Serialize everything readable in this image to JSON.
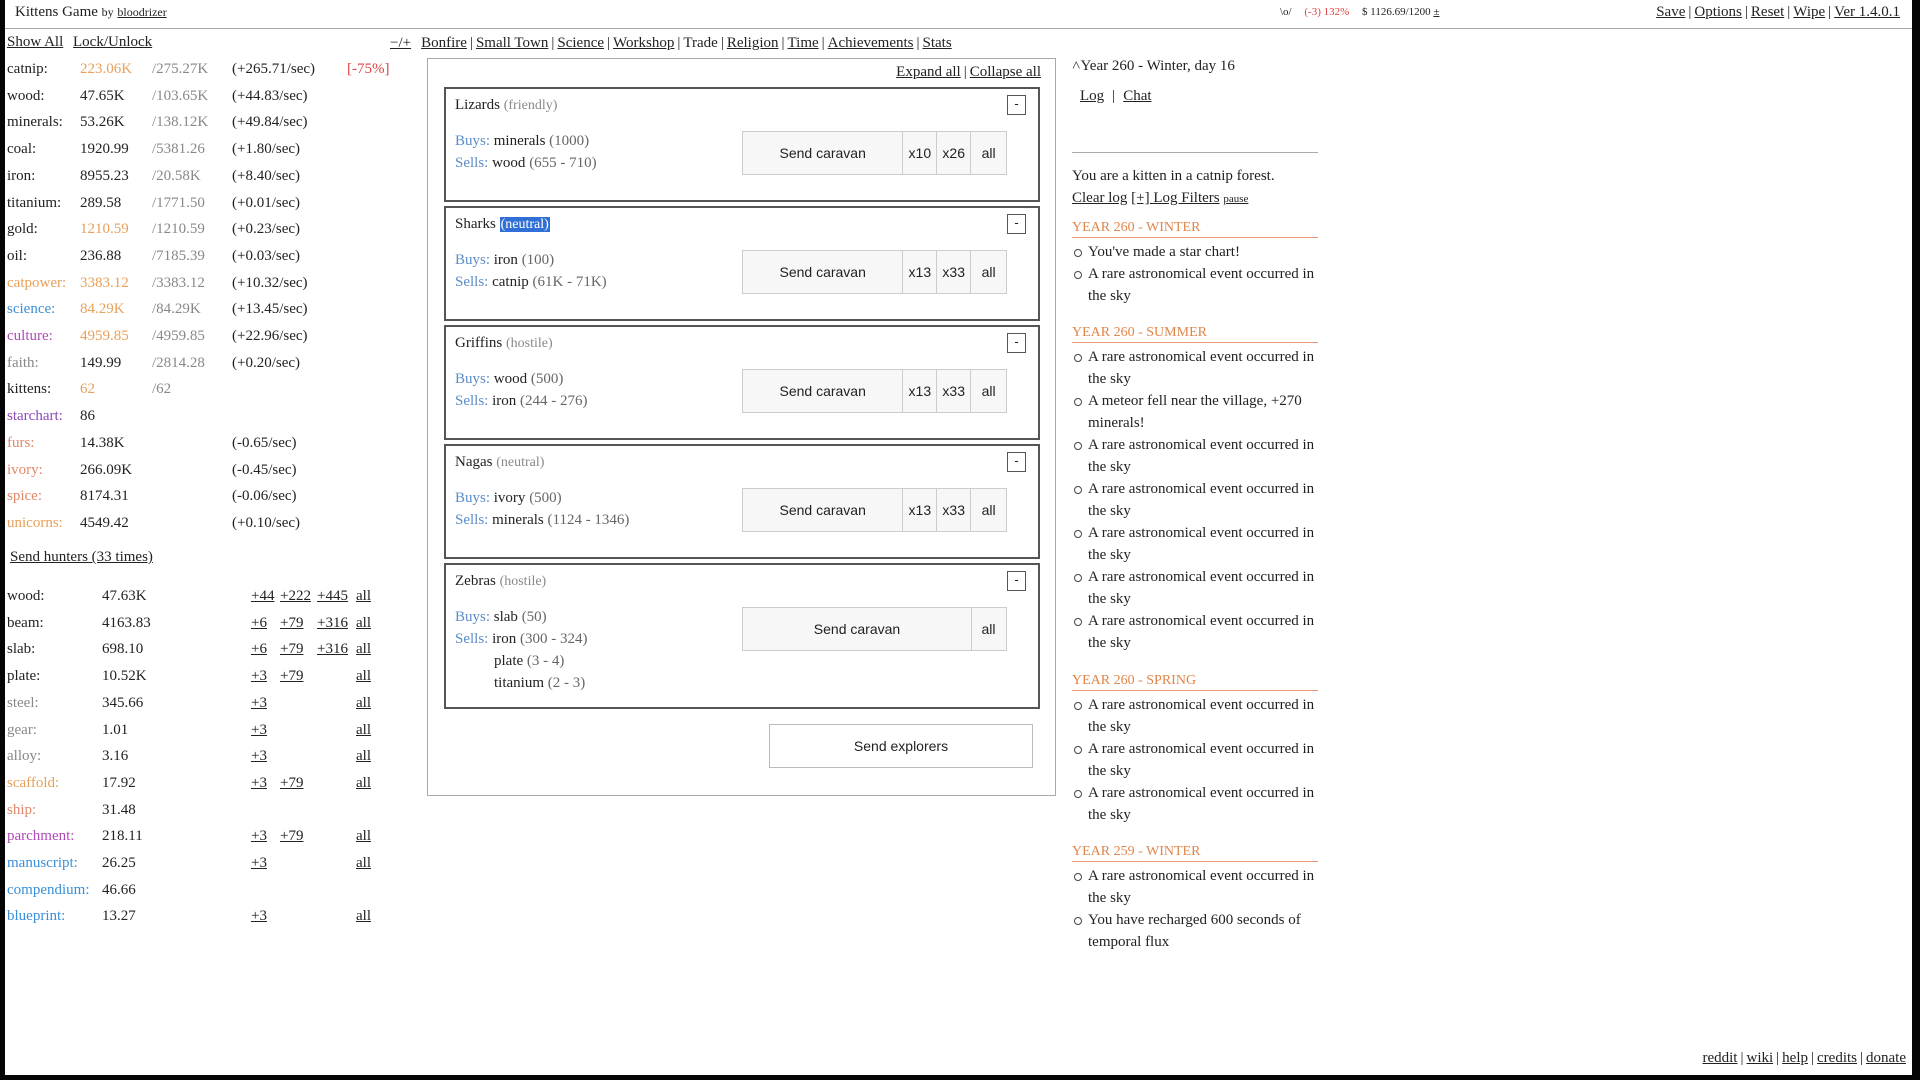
{
  "header": {
    "title": "Kittens Game",
    "by": "by",
    "author": "bloodrizer",
    "status_icon": "\\o/",
    "status_happiness": "(-3) 132%",
    "status_money": "$ 1126.69/1200",
    "status_more": "±",
    "menu": [
      "Save",
      "Options",
      "Reset",
      "Wipe",
      "Ver 1.4.0.1"
    ]
  },
  "left_controls": {
    "show_all": "Show All",
    "lock_unlock": "Lock/Unlock"
  },
  "resources": [
    {
      "name": "catnip:",
      "amount": "223.06K",
      "max": "/275.27K",
      "rate": "(+265.71/sec)",
      "mod": "[-75%]",
      "name_color": "#222",
      "amount_color": "#e8a05a"
    },
    {
      "name": "wood:",
      "amount": "47.65K",
      "max": "/103.65K",
      "rate": "(+44.83/sec)",
      "mod": "",
      "name_color": "#222",
      "amount_color": "#222"
    },
    {
      "name": "minerals:",
      "amount": "53.26K",
      "max": "/138.12K",
      "rate": "(+49.84/sec)",
      "mod": "",
      "name_color": "#222",
      "amount_color": "#222"
    },
    {
      "name": "coal:",
      "amount": "1920.99",
      "max": "/5381.26",
      "rate": "(+1.80/sec)",
      "mod": "",
      "name_color": "#222",
      "amount_color": "#222"
    },
    {
      "name": "iron:",
      "amount": "8955.23",
      "max": "/20.58K",
      "rate": "(+8.40/sec)",
      "mod": "",
      "name_color": "#222",
      "amount_color": "#222"
    },
    {
      "name": "titanium:",
      "amount": "289.58",
      "max": "/1771.50",
      "rate": "(+0.01/sec)",
      "mod": "",
      "name_color": "#222",
      "amount_color": "#222"
    },
    {
      "name": "gold:",
      "amount": "1210.59",
      "max": "/1210.59",
      "rate": "(+0.23/sec)",
      "mod": "",
      "name_color": "#222",
      "amount_color": "#e8a05a"
    },
    {
      "name": "oil:",
      "amount": "236.88",
      "max": "/7185.39",
      "rate": "(+0.03/sec)",
      "mod": "",
      "name_color": "#222",
      "amount_color": "#222"
    },
    {
      "name": "catpower:",
      "amount": "3383.12",
      "max": "/3383.12",
      "rate": "(+10.32/sec)",
      "mod": "",
      "name_color": "#e8a05a",
      "amount_color": "#e8a05a"
    },
    {
      "name": "science:",
      "amount": "84.29K",
      "max": "/84.29K",
      "rate": "(+13.45/sec)",
      "mod": "",
      "name_color": "#3a8fd8",
      "amount_color": "#e8a05a"
    },
    {
      "name": "culture:",
      "amount": "4959.85",
      "max": "/4959.85",
      "rate": "(+22.96/sec)",
      "mod": "",
      "name_color": "#b04ab8",
      "amount_color": "#e8a05a"
    },
    {
      "name": "faith:",
      "amount": "149.99",
      "max": "/2814.28",
      "rate": "(+0.20/sec)",
      "mod": "",
      "name_color": "#888",
      "amount_color": "#222"
    },
    {
      "name": "kittens:",
      "amount": "62",
      "max": "/62",
      "rate": "",
      "mod": "",
      "name_color": "#222",
      "amount_color": "#e8a05a"
    },
    {
      "name": "starchart:",
      "amount": "86",
      "max": "",
      "rate": "",
      "mod": "",
      "name_color": "#8a4ab8",
      "amount_color": "#222"
    },
    {
      "name": "furs:",
      "amount": "14.38K",
      "max": "",
      "rate": "(-0.65/sec)",
      "mod": "",
      "name_color": "#e0886a",
      "amount_color": "#222"
    },
    {
      "name": "ivory:",
      "amount": "266.09K",
      "max": "",
      "rate": "(-0.45/sec)",
      "mod": "",
      "name_color": "#e0886a",
      "amount_color": "#222"
    },
    {
      "name": "spice:",
      "amount": "8174.31",
      "max": "",
      "rate": "(-0.06/sec)",
      "mod": "",
      "name_color": "#e0886a",
      "amount_color": "#222"
    },
    {
      "name": "unicorns:",
      "amount": "4549.42",
      "max": "",
      "rate": "(+0.10/sec)",
      "mod": "",
      "name_color": "#e8a05a",
      "amount_color": "#222"
    }
  ],
  "send_hunters": "Send hunters (33 times)",
  "crafts": [
    {
      "name": "wood:",
      "amount": "47.63K",
      "a": "+44",
      "b": "+222",
      "c": "+445",
      "all": "all",
      "name_color": "#222"
    },
    {
      "name": "beam:",
      "amount": "4163.83",
      "a": "+6",
      "b": "+79",
      "c": "+316",
      "all": "all",
      "name_color": "#222"
    },
    {
      "name": "slab:",
      "amount": "698.10",
      "a": "+6",
      "b": "+79",
      "c": "+316",
      "all": "all",
      "name_color": "#222"
    },
    {
      "name": "plate:",
      "amount": "10.52K",
      "a": "+3",
      "b": "+79",
      "c": "",
      "all": "all",
      "name_color": "#222"
    },
    {
      "name": "steel:",
      "amount": "345.66",
      "a": "+3",
      "b": "",
      "c": "",
      "all": "all",
      "name_color": "#888"
    },
    {
      "name": "gear:",
      "amount": "1.01",
      "a": "+3",
      "b": "",
      "c": "",
      "all": "all",
      "name_color": "#888"
    },
    {
      "name": "alloy:",
      "amount": "3.16",
      "a": "+3",
      "b": "",
      "c": "",
      "all": "all",
      "name_color": "#888"
    },
    {
      "name": "scaffold:",
      "amount": "17.92",
      "a": "+3",
      "b": "+79",
      "c": "",
      "all": "all",
      "name_color": "#e8a05a"
    },
    {
      "name": "ship:",
      "amount": "31.48",
      "a": "",
      "b": "",
      "c": "",
      "all": "",
      "name_color": "#e0886a"
    },
    {
      "name": "parchment:",
      "amount": "218.11",
      "a": "+3",
      "b": "+79",
      "c": "",
      "all": "all",
      "name_color": "#b04ab8"
    },
    {
      "name": "manuscript:",
      "amount": "26.25",
      "a": "+3",
      "b": "",
      "c": "",
      "all": "all",
      "name_color": "#3a8fd8"
    },
    {
      "name": "compendium:",
      "amount": "46.66",
      "a": "",
      "b": "",
      "c": "",
      "all": "",
      "name_color": "#3a8fd8"
    },
    {
      "name": "blueprint:",
      "amount": "13.27",
      "a": "+3",
      "b": "",
      "c": "",
      "all": "all",
      "name_color": "#3a8fd8"
    }
  ],
  "tabs": {
    "toggle": "−/+",
    "items": [
      "Bonfire",
      "Small Town",
      "Science",
      "Workshop",
      "Trade",
      "Religion",
      "Time",
      "Achievements",
      "Stats"
    ],
    "active": "Trade"
  },
  "trade": {
    "expand_all": "Expand all",
    "collapse_all": "Collapse all",
    "buys_label": "Buys:",
    "sells_label": "Sells:",
    "collapse_symbol": "-",
    "send_caravan": "Send caravan",
    "all": "all",
    "send_explorers": "Send explorers",
    "races": [
      {
        "name": "Lizards",
        "attitude": "(friendly)",
        "buys_item": "minerals",
        "buys_amt": "(1000)",
        "sells_item": "wood",
        "sells_amt": "(655 - 710)",
        "m1": "x10",
        "m2": "x26"
      },
      {
        "name": "Sharks",
        "attitude": "(neutral)",
        "buys_item": "iron",
        "buys_amt": "(100)",
        "sells_item": "catnip",
        "sells_amt": "(61K - 71K)",
        "m1": "x13",
        "m2": "x33"
      },
      {
        "name": "Griffins",
        "attitude": "(hostile)",
        "buys_item": "wood",
        "buys_amt": "(500)",
        "sells_item": "iron",
        "sells_amt": "(244 - 276)",
        "m1": "x13",
        "m2": "x33"
      },
      {
        "name": "Nagas",
        "attitude": "(neutral)",
        "buys_item": "ivory",
        "buys_amt": "(500)",
        "sells_item": "minerals",
        "sells_amt": "(1124 - 1346)",
        "m1": "x13",
        "m2": "x33"
      },
      {
        "name": "Zebras",
        "attitude": "(hostile)",
        "buys_item": "slab",
        "buys_amt": "(50)",
        "sells_item": "iron",
        "sells_amt": "(300 - 324)",
        "extra1_item": "plate",
        "extra1_amt": "(3 - 4)",
        "extra2_item": "titanium",
        "extra2_amt": "(2 - 3)"
      }
    ]
  },
  "log": {
    "calendar": "Year 260 - Winter, day 16",
    "tab_log": "Log",
    "tab_chat": "Chat",
    "intro": "You are a kitten in a catnip forest.",
    "clear_log": "Clear log",
    "filters": "[+] Log Filters",
    "pause": "pause",
    "sections": [
      {
        "title": "YEAR 260 - WINTER",
        "items": [
          "You've made a star chart!",
          "A rare astronomical event occurred in the sky"
        ]
      },
      {
        "title": "YEAR 260 - SUMMER",
        "items": [
          "A rare astronomical event occurred in the sky",
          "A meteor fell near the village, +270 minerals!",
          "A rare astronomical event occurred in the sky",
          "A rare astronomical event occurred in the sky",
          "A rare astronomical event occurred in the sky",
          "A rare astronomical event occurred in the sky",
          "A rare astronomical event occurred in the sky"
        ]
      },
      {
        "title": "YEAR 260 - SPRING",
        "items": [
          "A rare astronomical event occurred in the sky",
          "A rare astronomical event occurred in the sky",
          "A rare astronomical event occurred in the sky"
        ]
      },
      {
        "title": "YEAR 259 - WINTER",
        "items": [
          "A rare astronomical event occurred in the sky",
          "You have recharged 600 seconds of temporal flux"
        ]
      }
    ]
  },
  "footer": [
    "reddit",
    "wiki",
    "help",
    "credits",
    "donate"
  ]
}
